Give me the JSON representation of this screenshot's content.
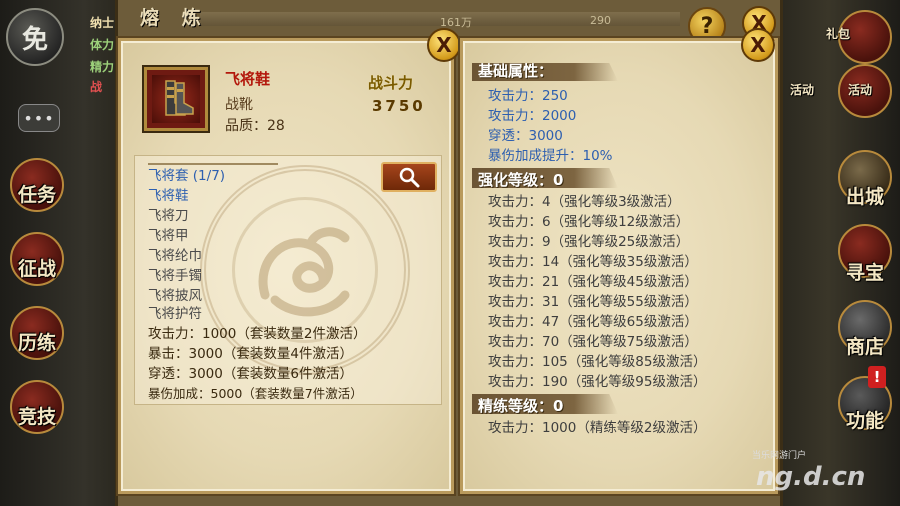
{
  "background": {
    "left_badge": "免",
    "chat_label": "•••",
    "left_buttons": [
      "任务",
      "征战",
      "历练",
      "竞技"
    ],
    "right_buttons": [
      "出城",
      "寻宝",
      "商店",
      "功能"
    ],
    "right_top_small": [
      "礼包",
      "活动",
      "活动"
    ],
    "top_small_left": [
      "纳士",
      "体力",
      "精力",
      "战"
    ],
    "topbar_numbers": [
      "161万",
      "290"
    ],
    "alert_mark": "!",
    "watermark": "当乐网游门户",
    "watermark_logo": "ng.d.cn"
  },
  "dialog": {
    "title": "熔 炼",
    "help_label": "?",
    "close_label": "X"
  },
  "item": {
    "icon": "boots-icon",
    "name": "飞将鞋",
    "type": "战靴",
    "quality": "品质：28",
    "power_label": "战斗力",
    "power_value": "3750"
  },
  "set": {
    "title": "飞将套 (1/7)",
    "pieces": [
      {
        "name": "飞将鞋",
        "owned": true
      },
      {
        "name": "飞将刀",
        "owned": false
      },
      {
        "name": "飞将甲",
        "owned": false
      },
      {
        "name": "飞将纶巾",
        "owned": false
      },
      {
        "name": "飞将手镯",
        "owned": false
      },
      {
        "name": "飞将披风",
        "owned": false
      },
      {
        "name": "飞将护符",
        "owned": false
      }
    ],
    "bonuses": [
      "攻击力：1000（套装数量2件激活）",
      "暴击：3000（套装数量4件激活）",
      "穿透：3000（套装数量6件激活）",
      "暴伤加成：5000（套装数量7件激活）"
    ]
  },
  "base_attributes": {
    "header": "基础属性：",
    "lines": [
      "攻击力：250",
      "攻击力：2000",
      "穿透：3000",
      "暴伤加成提升：10%"
    ]
  },
  "enhance": {
    "header": "强化等级：0",
    "lines": [
      "攻击力：4（强化等级3级激活）",
      "攻击力：6（强化等级12级激活）",
      "攻击力：9（强化等级25级激活）",
      "攻击力：14（强化等级35级激活）",
      "攻击力：21（强化等级45级激活）",
      "攻击力：31（强化等级55级激活）",
      "攻击力：47（强化等级65级激活）",
      "攻击力：70（强化等级75级激活）",
      "攻击力：105（强化等级85级激活）",
      "攻击力：190（强化等级95级激活）"
    ]
  },
  "refine": {
    "header": "精练等级：0",
    "lines": [
      "攻击力：1000（精练等级2级激活）"
    ]
  }
}
